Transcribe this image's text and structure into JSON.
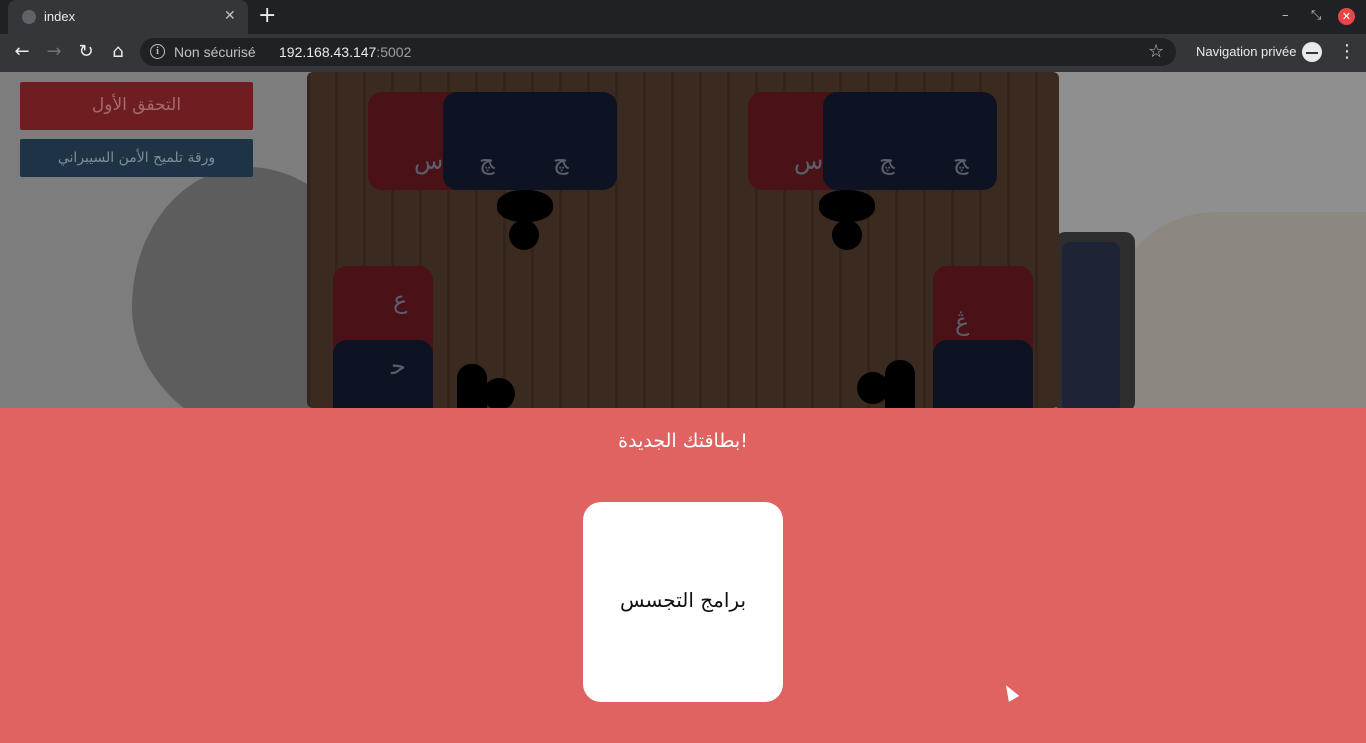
{
  "browser": {
    "tab_title": "index",
    "tab_close_glyph": "✕",
    "new_tab_glyph": "+",
    "security_label": "Non sécurisé",
    "url_host": "192.168.43.147",
    "url_port": ":5002",
    "private_label": "Navigation privée",
    "icons": {
      "back": "back-arrow-icon",
      "forward": "forward-arrow-icon",
      "reload": "reload-icon",
      "home": "home-icon",
      "info": "info-icon",
      "star": "star-icon",
      "incognito": "incognito-icon",
      "menu": "kebab-menu-icon"
    }
  },
  "game": {
    "buttons": {
      "first_check": "التحقق الأول",
      "hint_sheet": "ورقة تلميح الأمن السيبراني"
    },
    "board_cards": [
      {
        "glyph": "س"
      },
      {
        "glyph": "ﭻ"
      },
      {
        "glyph": "ﭻ"
      },
      {
        "glyph": "س"
      },
      {
        "glyph": "ﭻ"
      },
      {
        "glyph": "ﭻ"
      },
      {
        "glyph": "ع"
      },
      {
        "glyph": "ﺣ"
      },
      {
        "glyph": "ڠ"
      }
    ]
  },
  "modal": {
    "title": "بطاقتك الجديدة!",
    "card_label": "برامج التجسس"
  },
  "colors": {
    "panel_bg": "#e06361",
    "card_bg": "#ffffff",
    "btn_first_bg": "#6e1e21",
    "btn_hint_bg": "#1f3346"
  }
}
